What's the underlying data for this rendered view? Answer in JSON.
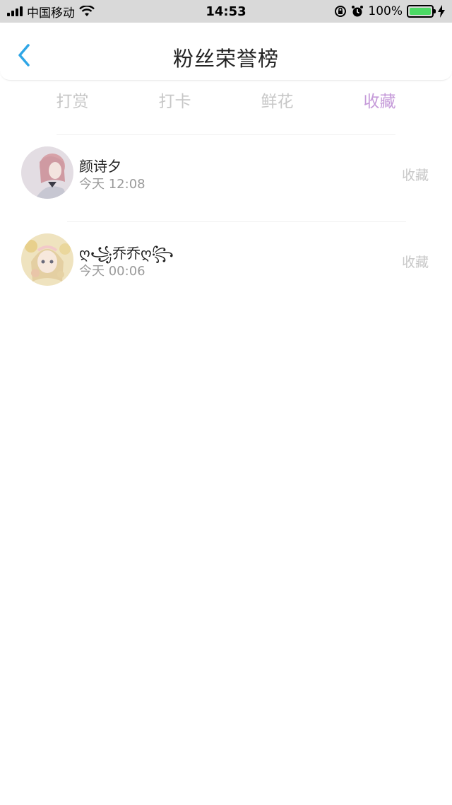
{
  "status_bar": {
    "carrier": "中国移动",
    "time": "14:53",
    "battery_percent": "100%",
    "battery_level": 1.0,
    "icons": [
      "signal-icon",
      "wifi-icon",
      "orientation-lock-icon",
      "alarm-icon",
      "battery-icon",
      "charging-icon"
    ]
  },
  "nav": {
    "title": "粉丝荣誉榜",
    "back_icon": "chevron-left-icon",
    "accent_color": "#2fa6e6"
  },
  "tabs": [
    {
      "label": "打赏",
      "active": false
    },
    {
      "label": "打卡",
      "active": false
    },
    {
      "label": "鲜花",
      "active": false
    },
    {
      "label": "收藏",
      "active": true
    }
  ],
  "colors": {
    "tab_active": "#c59ad9",
    "tab_inactive": "#c7c7c7"
  },
  "list": [
    {
      "name": "颜诗夕",
      "time": "今天 12:08",
      "action": "收藏"
    },
    {
      "name": "ღ꧁乔乔ღ꧂",
      "time": "今天 00:06",
      "action": "收藏"
    }
  ]
}
